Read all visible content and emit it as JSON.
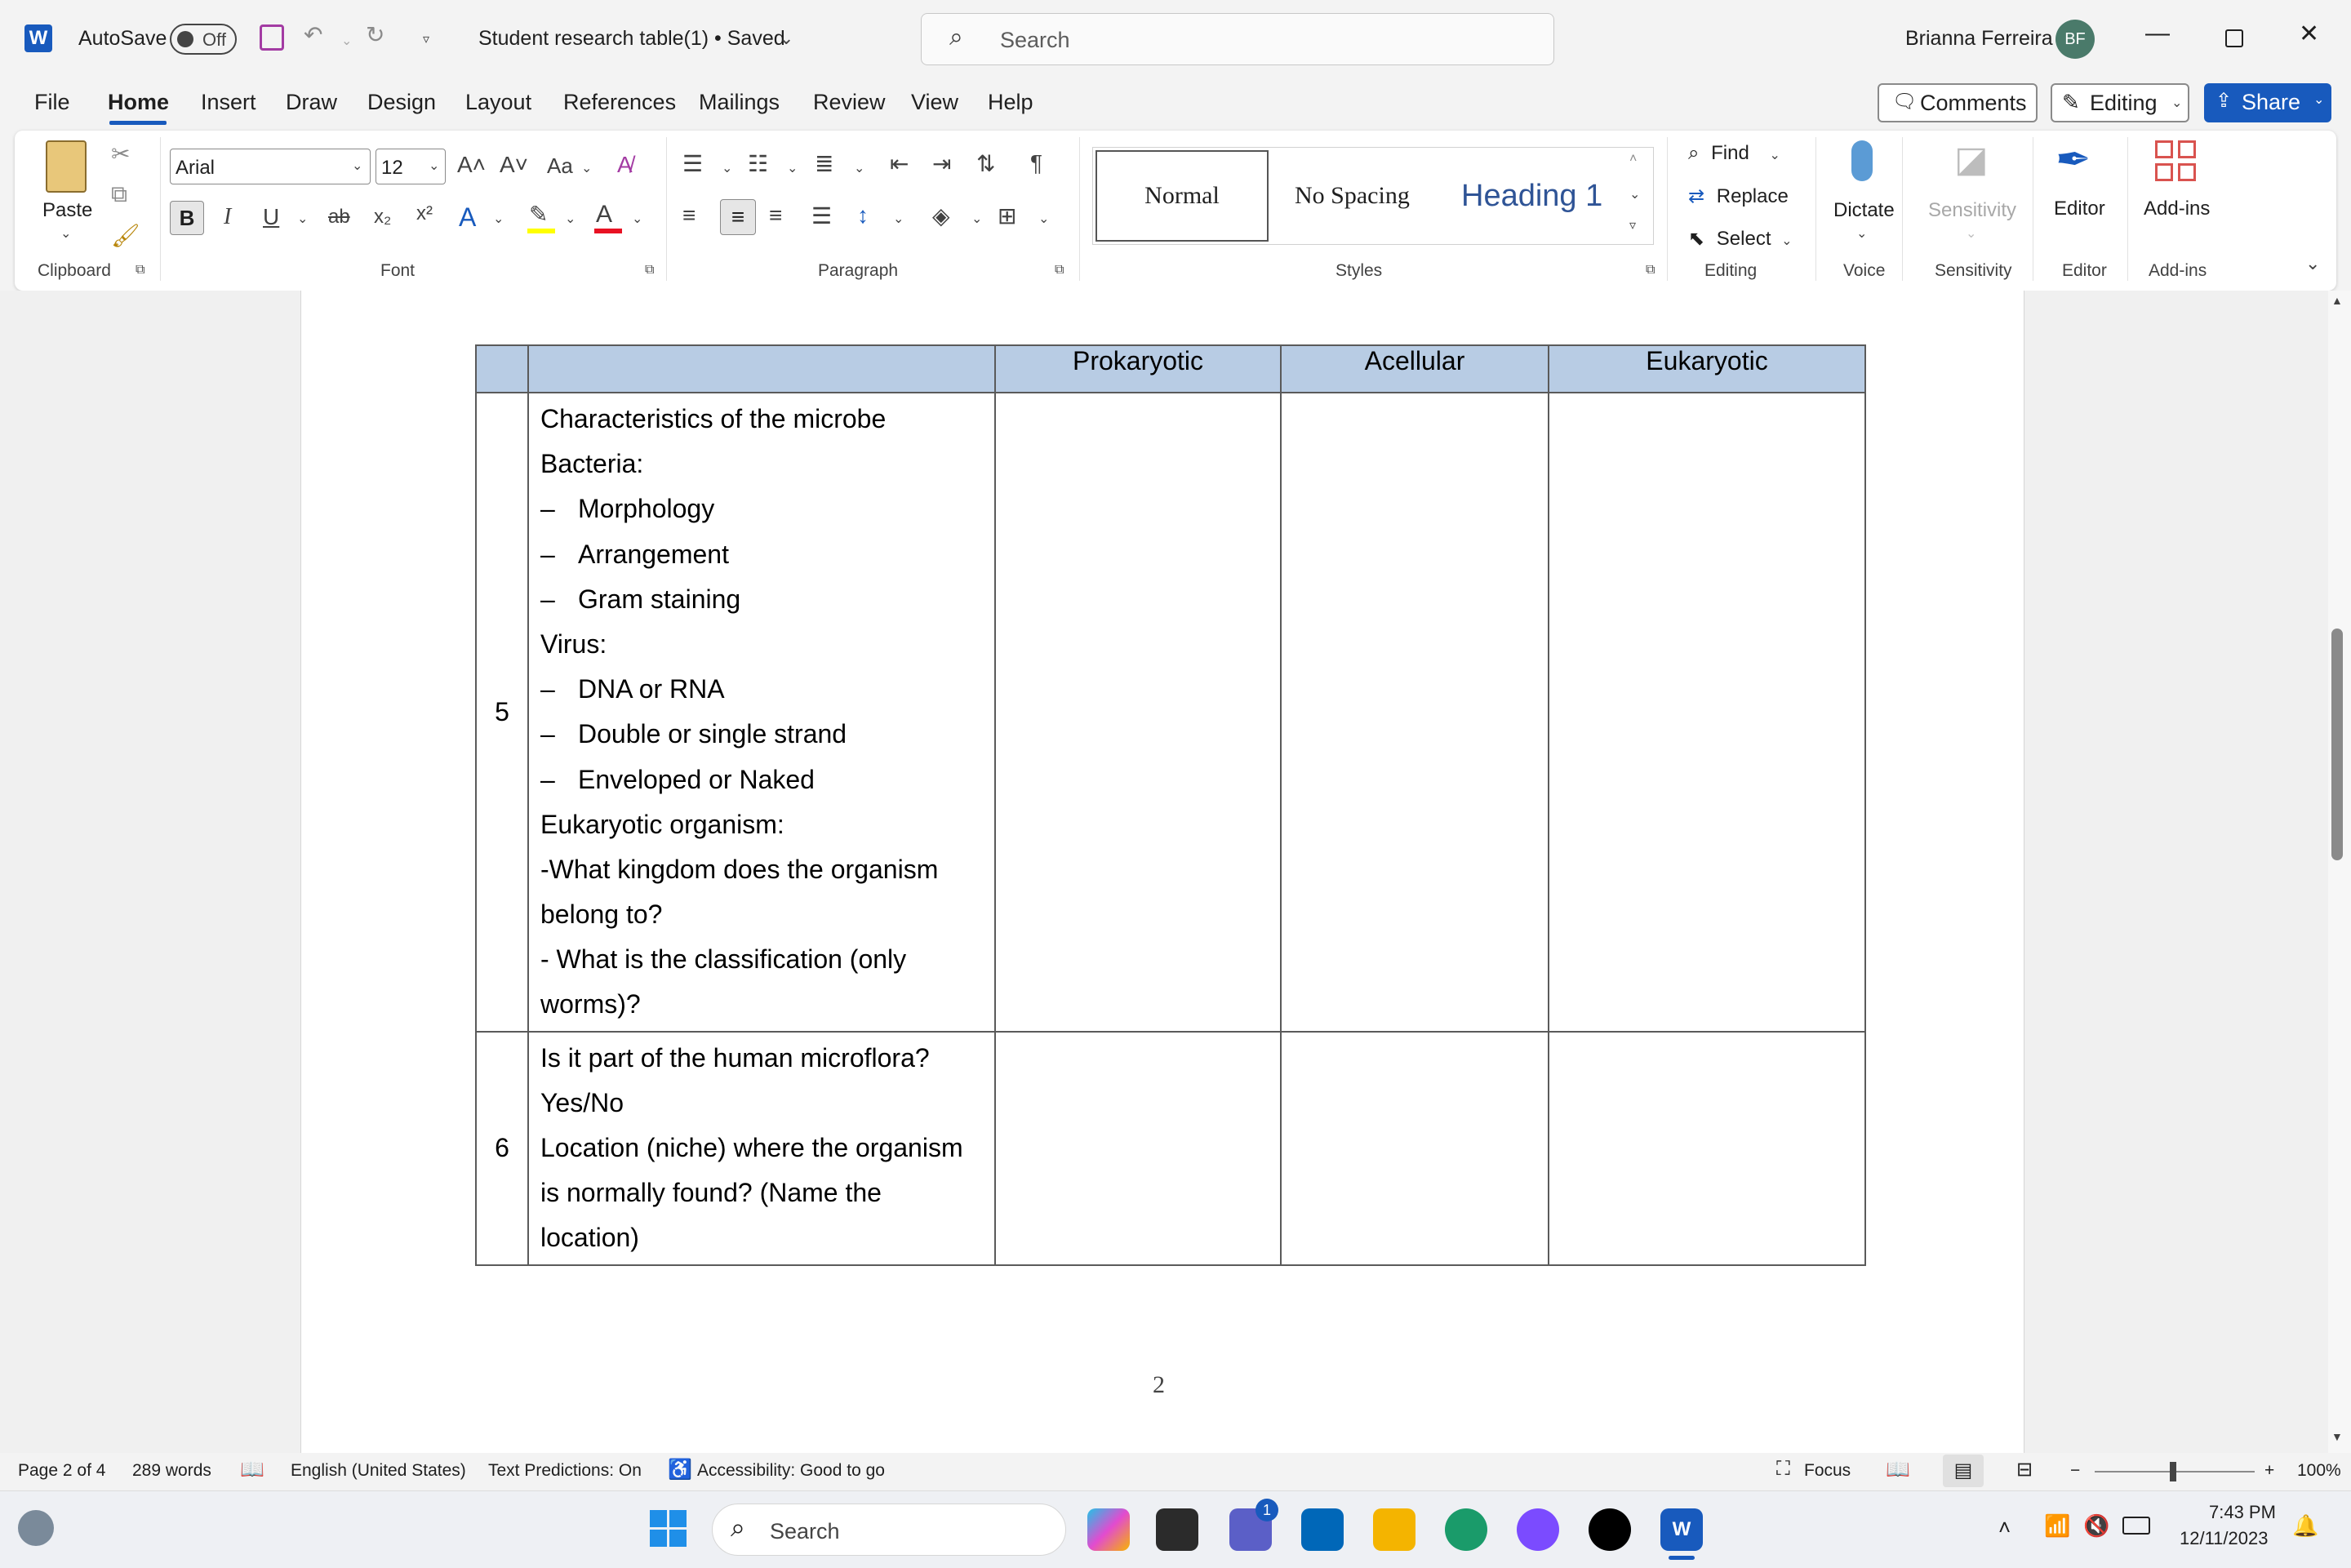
{
  "titlebar": {
    "autosave_label": "AutoSave",
    "autosave_state": "Off",
    "doc_title": "Student research table(1) • Saved",
    "search_placeholder": "Search",
    "user_name": "Brianna Ferreira",
    "user_initials": "BF"
  },
  "menu": {
    "tabs": [
      "File",
      "Home",
      "Insert",
      "Draw",
      "Design",
      "Layout",
      "References",
      "Mailings",
      "Review",
      "View",
      "Help"
    ],
    "active_tab": "Home",
    "comments_label": "Comments",
    "editing_label": "Editing",
    "share_label": "Share"
  },
  "ribbon": {
    "clipboard": {
      "paste_label": "Paste",
      "group_label": "Clipboard"
    },
    "font": {
      "font_name": "Arial",
      "font_size": "12",
      "case_label": "Aa",
      "group_label": "Font"
    },
    "paragraph": {
      "group_label": "Paragraph"
    },
    "styles": {
      "items": [
        "Normal",
        "No Spacing",
        "Heading 1"
      ],
      "group_label": "Styles"
    },
    "editing": {
      "find_label": "Find",
      "replace_label": "Replace",
      "select_label": "Select",
      "group_label": "Editing"
    },
    "voice": {
      "dictate_label": "Dictate",
      "group_label": "Voice"
    },
    "sensitivity": {
      "button_label": "Sensitivity",
      "group_label": "Sensitivity"
    },
    "editor": {
      "button_label": "Editor",
      "group_label": "Editor"
    },
    "addins": {
      "button_label": "Add-ins",
      "group_label": "Add-ins"
    }
  },
  "document": {
    "table": {
      "headers": [
        "",
        "",
        "Prokaryotic",
        "Acellular",
        "Eukaryotic"
      ],
      "rows": [
        {
          "number": "5",
          "lines": [
            {
              "dash": "",
              "text": "Characteristics of the microbe"
            },
            {
              "dash": "",
              "text": "Bacteria:"
            },
            {
              "dash": "–",
              "text": "Morphology"
            },
            {
              "dash": "–",
              "text": "Arrangement"
            },
            {
              "dash": "–",
              "text": "Gram staining"
            },
            {
              "dash": "",
              "text": "Virus:"
            },
            {
              "dash": "–",
              "text": "DNA or RNA"
            },
            {
              "dash": "–",
              "text": "Double or single strand"
            },
            {
              "dash": "–",
              "text": "Enveloped or Naked"
            },
            {
              "dash": "",
              "text": "Eukaryotic organism:"
            },
            {
              "dash": "",
              "text": "-What kingdom does the organism"
            },
            {
              "dash": "",
              "text": "belong to?"
            },
            {
              "dash": "",
              "text": "- What is the classification (only"
            },
            {
              "dash": "",
              "text": "worms)?"
            }
          ]
        },
        {
          "number": "6",
          "lines": [
            {
              "dash": "",
              "text": "Is it part of the human microflora?"
            },
            {
              "dash": "",
              "text": "Yes/No"
            },
            {
              "dash": "",
              "text": "Location (niche) where the organism"
            },
            {
              "dash": "",
              "text": "is normally found? (Name the"
            },
            {
              "dash": "",
              "text": "location)"
            }
          ]
        }
      ]
    },
    "page_number": "2"
  },
  "statusbar": {
    "page": "Page 2 of 4",
    "words": "289 words",
    "language": "English (United States)",
    "predictions": "Text Predictions: On",
    "accessibility": "Accessibility: Good to go",
    "focus": "Focus",
    "zoom": "100%"
  },
  "taskbar": {
    "search_placeholder": "Search",
    "chat_badge": "1",
    "time": "7:43 PM",
    "date": "12/11/2023"
  }
}
